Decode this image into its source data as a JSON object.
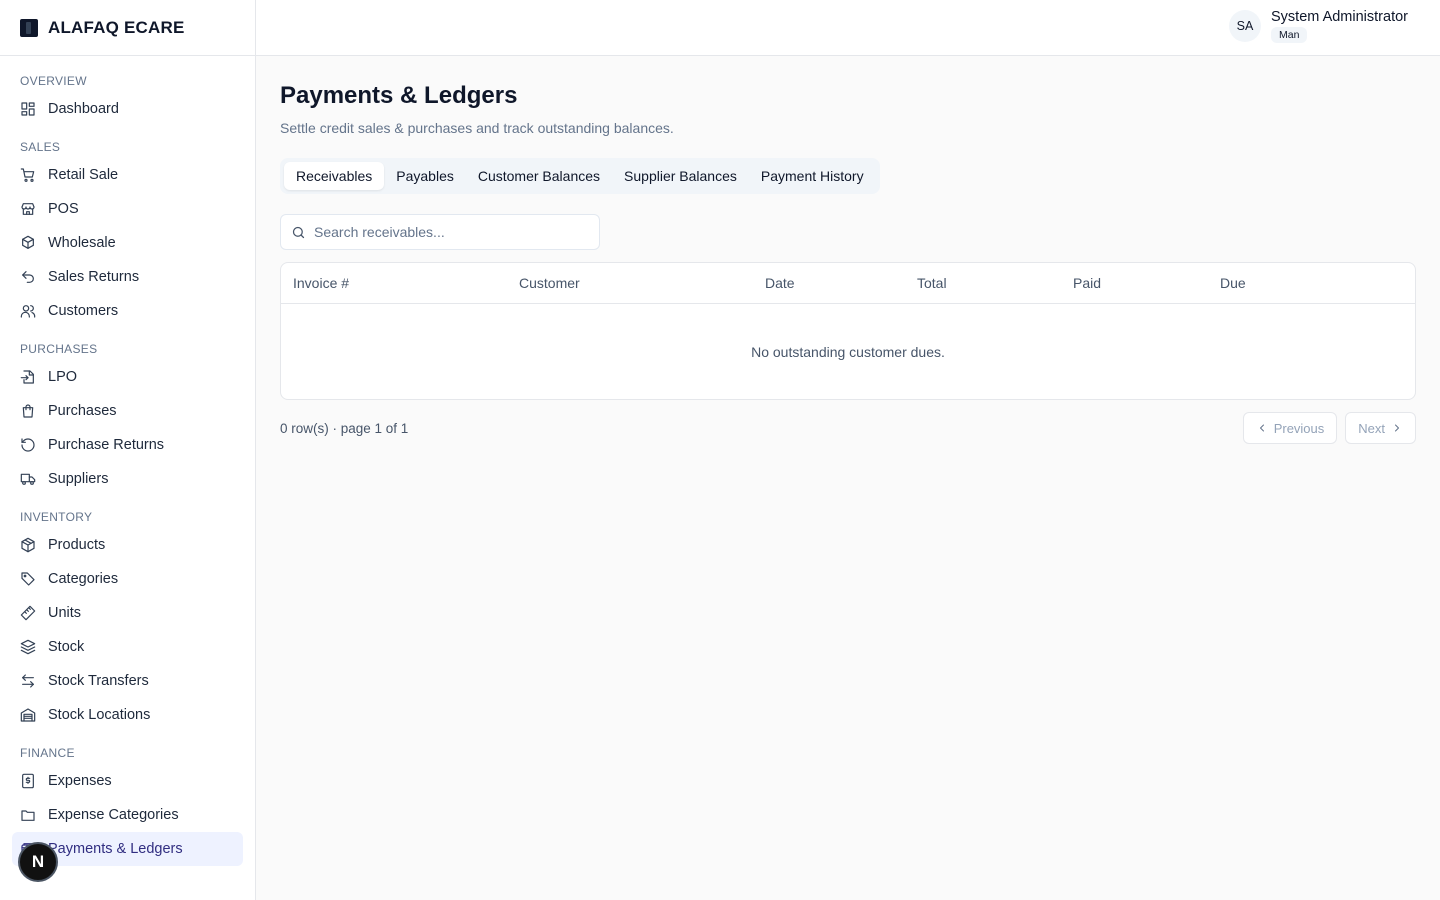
{
  "brand": {
    "name": "ALAFAQ ECARE"
  },
  "user": {
    "initials": "SA",
    "name": "System Administrator",
    "role": "Man"
  },
  "sidebar": {
    "sections": [
      {
        "title": "OVERVIEW",
        "items": [
          {
            "label": "Dashboard",
            "icon": "dashboard-icon"
          }
        ]
      },
      {
        "title": "SALES",
        "items": [
          {
            "label": "Retail Sale",
            "icon": "cart-icon"
          },
          {
            "label": "POS",
            "icon": "store-icon"
          },
          {
            "label": "Wholesale",
            "icon": "boxes-icon"
          },
          {
            "label": "Sales Returns",
            "icon": "undo-icon"
          },
          {
            "label": "Customers",
            "icon": "users-icon"
          }
        ]
      },
      {
        "title": "PURCHASES",
        "items": [
          {
            "label": "LPO",
            "icon": "file-import-icon"
          },
          {
            "label": "Purchases",
            "icon": "shopping-bag-icon"
          },
          {
            "label": "Purchase Returns",
            "icon": "rotate-ccw-icon"
          },
          {
            "label": "Suppliers",
            "icon": "truck-icon"
          }
        ]
      },
      {
        "title": "INVENTORY",
        "items": [
          {
            "label": "Products",
            "icon": "package-icon"
          },
          {
            "label": "Categories",
            "icon": "tag-icon"
          },
          {
            "label": "Units",
            "icon": "ruler-icon"
          },
          {
            "label": "Stock",
            "icon": "layers-icon"
          },
          {
            "label": "Stock Transfers",
            "icon": "arrows-left-right-icon"
          },
          {
            "label": "Stock Locations",
            "icon": "warehouse-icon"
          }
        ]
      },
      {
        "title": "FINANCE",
        "items": [
          {
            "label": "Expenses",
            "icon": "receipt-icon"
          },
          {
            "label": "Expense Categories",
            "icon": "folder-icon"
          },
          {
            "label": "Payments & Ledgers",
            "icon": "wallet-icon",
            "active": true
          }
        ]
      }
    ]
  },
  "page": {
    "title": "Payments & Ledgers",
    "subtitle": "Settle credit sales & purchases and track outstanding balances."
  },
  "tabs": [
    "Receivables",
    "Payables",
    "Customer Balances",
    "Supplier Balances",
    "Payment History"
  ],
  "search": {
    "placeholder": "Search receivables..."
  },
  "table": {
    "columns": [
      "Invoice #",
      "Customer",
      "Date",
      "Total",
      "Paid",
      "Due"
    ],
    "empty_message": "No outstanding customer dues."
  },
  "footer": {
    "count_text": "0 row(s) · page 1 of 1",
    "previous": "Previous",
    "next": "Next"
  },
  "floating_badge": {
    "letter": "N"
  }
}
